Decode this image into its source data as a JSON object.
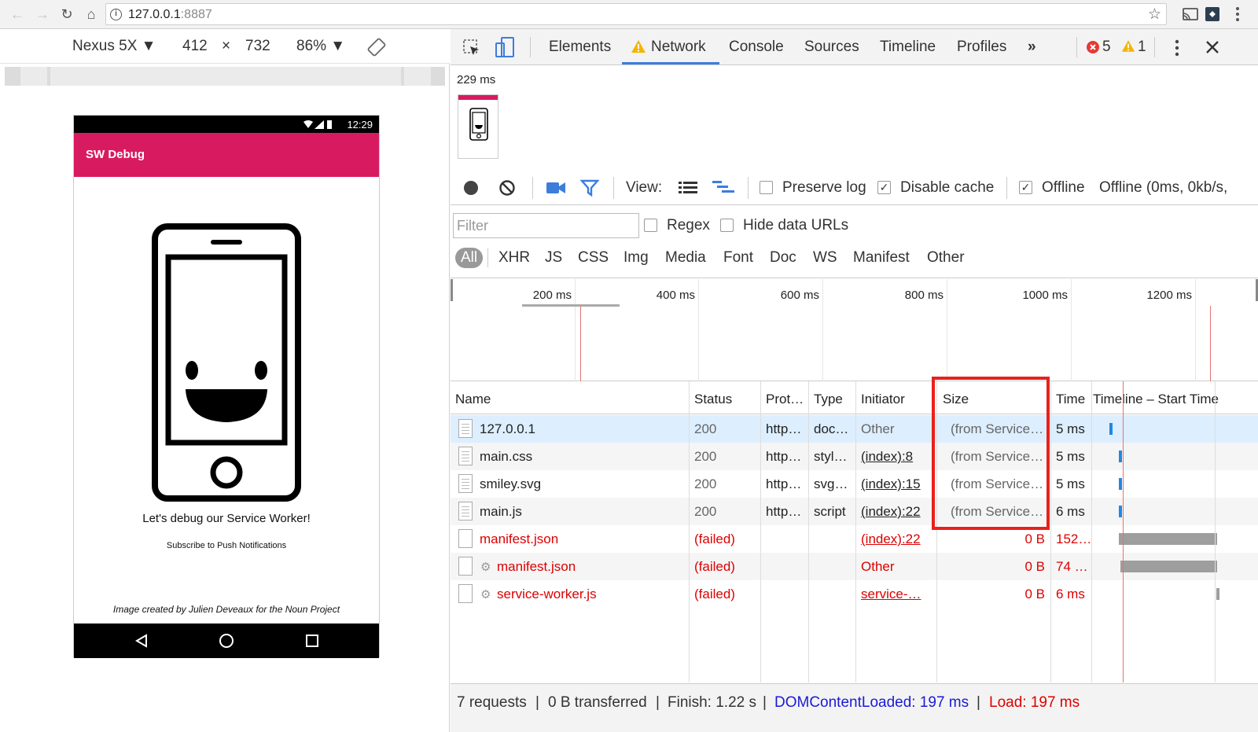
{
  "browser": {
    "url_host": "127.0.0.1",
    "url_port": ":8887",
    "icons": [
      "back-icon",
      "forward-icon",
      "reload-icon",
      "home-icon",
      "info-icon",
      "star-icon",
      "cast-icon",
      "extension-icon",
      "menu-icon"
    ]
  },
  "device": {
    "name": "Nexus 5X ▼",
    "width": "412",
    "times": "×",
    "height": "732",
    "zoom": "86% ▼"
  },
  "phone": {
    "time": "12:29",
    "app_title": "SW Debug",
    "headline": "Let's debug our Service Worker!",
    "subscribe": "Subscribe to Push Notifications",
    "credit": "Image created by Julien Deveaux for the Noun Project"
  },
  "devtools": {
    "tabs": [
      "Elements",
      "Network",
      "Console",
      "Sources",
      "Timeline",
      "Profiles"
    ],
    "more": "»",
    "error_count": "5",
    "warning_count": "1",
    "filmstrip_time": "229 ms"
  },
  "net_toolbar": {
    "view_label": "View:",
    "preserve_log": "Preserve log",
    "disable_cache": "Disable cache",
    "offline": "Offline",
    "throttle": "Offline (0ms, 0kb/s,"
  },
  "filter": {
    "placeholder": "Filter",
    "regex": "Regex",
    "hide_data_urls": "Hide data URLs",
    "types": [
      "All",
      "XHR",
      "JS",
      "CSS",
      "Img",
      "Media",
      "Font",
      "Doc",
      "WS",
      "Manifest",
      "Other"
    ]
  },
  "overview": {
    "ticks": [
      "200 ms",
      "400 ms",
      "600 ms",
      "800 ms",
      "1000 ms",
      "1200 ms"
    ]
  },
  "table": {
    "headers": [
      "Name",
      "Status",
      "Prot…",
      "Type",
      "Initiator",
      "Size",
      "Time",
      "Timeline – Start Time"
    ],
    "rows": [
      {
        "name": "127.0.0.1",
        "status": "200",
        "proto": "http…",
        "type": "doc…",
        "initiator": "Other",
        "size": "(from Service…",
        "time": "5 ms"
      },
      {
        "name": "main.css",
        "status": "200",
        "proto": "http…",
        "type": "styl…",
        "initiator": "(index):8",
        "size": "(from Service…",
        "time": "5 ms"
      },
      {
        "name": "smiley.svg",
        "status": "200",
        "proto": "http…",
        "type": "svg…",
        "initiator": "(index):15",
        "size": "(from Service…",
        "time": "5 ms"
      },
      {
        "name": "main.js",
        "status": "200",
        "proto": "http…",
        "type": "script",
        "initiator": "(index):22",
        "size": "(from Service…",
        "time": "6 ms"
      },
      {
        "name": "manifest.json",
        "status": "(failed)",
        "proto": "",
        "type": "",
        "initiator": "(index):22",
        "size": "0 B",
        "time": "152…"
      },
      {
        "name": "manifest.json",
        "status": "(failed)",
        "proto": "",
        "type": "",
        "initiator": "Other",
        "size": "0 B",
        "time": "74 …"
      },
      {
        "name": "service-worker.js",
        "status": "(failed)",
        "proto": "",
        "type": "",
        "initiator": "service-…",
        "size": "0 B",
        "time": "6 ms"
      }
    ]
  },
  "summary": {
    "requests": "7 requests",
    "transferred": "0 B transferred",
    "finish": "Finish: 1.22 s",
    "dom": "DOMContentLoaded: 197 ms",
    "load": "Load: 197 ms",
    "sep": "|"
  },
  "colors": {
    "accent": "#d81b60",
    "highlight": "#e8211b",
    "link_blue": "#1a1ad8",
    "error_red": "#dd0000"
  }
}
